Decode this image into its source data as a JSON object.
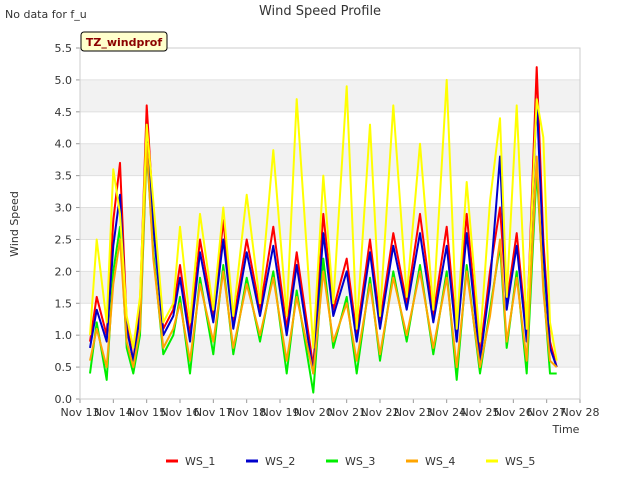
{
  "chart_data": {
    "type": "line",
    "title": "Wind Speed Profile",
    "note": "No data for f_u",
    "badge": "TZ_windprof",
    "xlabel": "Time",
    "ylabel": "Wind Speed",
    "ylim": [
      0.0,
      5.5
    ],
    "yticks": [
      "0.0",
      "0.5",
      "1.0",
      "1.5",
      "2.0",
      "2.5",
      "3.0",
      "3.5",
      "4.0",
      "4.5",
      "5.0",
      "5.5"
    ],
    "xticks": [
      "Nov 13",
      "Nov 14",
      "Nov 15",
      "Nov 16",
      "Nov 17",
      "Nov 18",
      "Nov 19",
      "Nov 20",
      "Nov 21",
      "Nov 22",
      "Nov 23",
      "Nov 24",
      "Nov 25",
      "Nov 26",
      "Nov 27",
      "Nov 28"
    ],
    "xlim_days": [
      13,
      28
    ],
    "grid": true,
    "legend_position": "bottom",
    "series": [
      {
        "name": "WS_1",
        "color": "#ff0000",
        "values": [
          [
            13.3,
            0.9
          ],
          [
            13.5,
            1.6
          ],
          [
            13.8,
            1.0
          ],
          [
            14.0,
            2.8
          ],
          [
            14.2,
            3.7
          ],
          [
            14.4,
            1.2
          ],
          [
            14.6,
            0.6
          ],
          [
            14.8,
            1.5
          ],
          [
            15.0,
            4.6
          ],
          [
            15.2,
            2.9
          ],
          [
            15.5,
            1.1
          ],
          [
            15.8,
            1.4
          ],
          [
            16.0,
            2.1
          ],
          [
            16.3,
            1.0
          ],
          [
            16.6,
            2.5
          ],
          [
            17.0,
            1.3
          ],
          [
            17.3,
            2.8
          ],
          [
            17.6,
            1.2
          ],
          [
            18.0,
            2.5
          ],
          [
            18.4,
            1.4
          ],
          [
            18.8,
            2.7
          ],
          [
            19.2,
            1.1
          ],
          [
            19.5,
            2.3
          ],
          [
            20.0,
            0.5
          ],
          [
            20.3,
            2.9
          ],
          [
            20.6,
            1.4
          ],
          [
            21.0,
            2.2
          ],
          [
            21.3,
            1.0
          ],
          [
            21.7,
            2.5
          ],
          [
            22.0,
            1.2
          ],
          [
            22.4,
            2.6
          ],
          [
            22.8,
            1.5
          ],
          [
            23.2,
            2.9
          ],
          [
            23.6,
            1.3
          ],
          [
            24.0,
            2.7
          ],
          [
            24.3,
            1.0
          ],
          [
            24.6,
            2.9
          ],
          [
            25.0,
            0.7
          ],
          [
            25.3,
            2.0
          ],
          [
            25.6,
            3.0
          ],
          [
            25.8,
            1.5
          ],
          [
            26.1,
            2.6
          ],
          [
            26.4,
            1.0
          ],
          [
            26.7,
            5.2
          ],
          [
            26.9,
            2.5
          ],
          [
            27.1,
            0.9
          ],
          [
            27.3,
            0.5
          ]
        ]
      },
      {
        "name": "WS_2",
        "color": "#0000cc",
        "values": [
          [
            13.3,
            0.8
          ],
          [
            13.5,
            1.4
          ],
          [
            13.8,
            0.9
          ],
          [
            14.0,
            2.4
          ],
          [
            14.2,
            3.2
          ],
          [
            14.4,
            1.1
          ],
          [
            14.6,
            0.6
          ],
          [
            14.8,
            1.3
          ],
          [
            15.0,
            4.3
          ],
          [
            15.2,
            2.7
          ],
          [
            15.5,
            1.0
          ],
          [
            15.8,
            1.3
          ],
          [
            16.0,
            1.9
          ],
          [
            16.3,
            0.9
          ],
          [
            16.6,
            2.3
          ],
          [
            17.0,
            1.2
          ],
          [
            17.3,
            2.5
          ],
          [
            17.6,
            1.1
          ],
          [
            18.0,
            2.3
          ],
          [
            18.4,
            1.3
          ],
          [
            18.8,
            2.4
          ],
          [
            19.2,
            1.0
          ],
          [
            19.5,
            2.1
          ],
          [
            20.0,
            0.4
          ],
          [
            20.3,
            2.6
          ],
          [
            20.6,
            1.3
          ],
          [
            21.0,
            2.0
          ],
          [
            21.3,
            0.9
          ],
          [
            21.7,
            2.3
          ],
          [
            22.0,
            1.1
          ],
          [
            22.4,
            2.4
          ],
          [
            22.8,
            1.4
          ],
          [
            23.2,
            2.6
          ],
          [
            23.6,
            1.2
          ],
          [
            24.0,
            2.4
          ],
          [
            24.3,
            0.9
          ],
          [
            24.6,
            2.6
          ],
          [
            25.0,
            0.6
          ],
          [
            25.3,
            1.8
          ],
          [
            25.6,
            3.8
          ],
          [
            25.8,
            1.4
          ],
          [
            26.1,
            2.4
          ],
          [
            26.4,
            0.9
          ],
          [
            26.7,
            4.7
          ],
          [
            26.9,
            2.3
          ],
          [
            27.1,
            0.8
          ],
          [
            27.3,
            0.5
          ]
        ]
      },
      {
        "name": "WS_3",
        "color": "#00ee00",
        "values": [
          [
            13.3,
            0.4
          ],
          [
            13.5,
            1.2
          ],
          [
            13.8,
            0.3
          ],
          [
            14.0,
            2.0
          ],
          [
            14.2,
            2.7
          ],
          [
            14.4,
            0.8
          ],
          [
            14.6,
            0.4
          ],
          [
            14.8,
            1.0
          ],
          [
            15.0,
            3.9
          ],
          [
            15.2,
            2.3
          ],
          [
            15.5,
            0.7
          ],
          [
            15.8,
            1.0
          ],
          [
            16.0,
            1.6
          ],
          [
            16.3,
            0.4
          ],
          [
            16.6,
            1.9
          ],
          [
            17.0,
            0.7
          ],
          [
            17.3,
            2.1
          ],
          [
            17.6,
            0.7
          ],
          [
            18.0,
            1.9
          ],
          [
            18.4,
            0.9
          ],
          [
            18.8,
            2.0
          ],
          [
            19.2,
            0.4
          ],
          [
            19.5,
            1.7
          ],
          [
            20.0,
            0.1
          ],
          [
            20.3,
            2.2
          ],
          [
            20.6,
            0.8
          ],
          [
            21.0,
            1.6
          ],
          [
            21.3,
            0.4
          ],
          [
            21.7,
            1.9
          ],
          [
            22.0,
            0.6
          ],
          [
            22.4,
            2.0
          ],
          [
            22.8,
            0.9
          ],
          [
            23.2,
            2.1
          ],
          [
            23.6,
            0.7
          ],
          [
            24.0,
            2.0
          ],
          [
            24.3,
            0.3
          ],
          [
            24.6,
            2.1
          ],
          [
            25.0,
            0.4
          ],
          [
            25.3,
            1.4
          ],
          [
            25.6,
            2.4
          ],
          [
            25.8,
            0.8
          ],
          [
            26.1,
            2.0
          ],
          [
            26.4,
            0.4
          ],
          [
            26.7,
            3.6
          ],
          [
            26.9,
            1.8
          ],
          [
            27.1,
            0.4
          ],
          [
            27.3,
            0.4
          ]
        ]
      },
      {
        "name": "WS_4",
        "color": "#ffa500",
        "values": [
          [
            13.3,
            0.6
          ],
          [
            13.5,
            1.1
          ],
          [
            13.8,
            0.5
          ],
          [
            14.0,
            1.8
          ],
          [
            14.2,
            2.5
          ],
          [
            14.4,
            0.9
          ],
          [
            14.6,
            0.5
          ],
          [
            14.8,
            1.1
          ],
          [
            15.0,
            4.0
          ],
          [
            15.2,
            2.2
          ],
          [
            15.5,
            0.8
          ],
          [
            15.8,
            1.1
          ],
          [
            16.0,
            1.5
          ],
          [
            16.3,
            0.6
          ],
          [
            16.6,
            1.8
          ],
          [
            17.0,
            0.9
          ],
          [
            17.3,
            2.0
          ],
          [
            17.6,
            0.8
          ],
          [
            18.0,
            1.8
          ],
          [
            18.4,
            1.0
          ],
          [
            18.8,
            1.9
          ],
          [
            19.2,
            0.6
          ],
          [
            19.5,
            1.6
          ],
          [
            20.0,
            0.4
          ],
          [
            20.3,
            2.0
          ],
          [
            20.6,
            0.9
          ],
          [
            21.0,
            1.5
          ],
          [
            21.3,
            0.6
          ],
          [
            21.7,
            1.8
          ],
          [
            22.0,
            0.7
          ],
          [
            22.4,
            1.9
          ],
          [
            22.8,
            1.0
          ],
          [
            23.2,
            2.0
          ],
          [
            23.6,
            0.8
          ],
          [
            24.0,
            1.9
          ],
          [
            24.3,
            0.5
          ],
          [
            24.6,
            2.0
          ],
          [
            25.0,
            0.5
          ],
          [
            25.3,
            1.3
          ],
          [
            25.6,
            2.5
          ],
          [
            25.8,
            0.9
          ],
          [
            26.1,
            1.9
          ],
          [
            26.4,
            0.6
          ],
          [
            26.7,
            3.8
          ],
          [
            26.9,
            1.7
          ],
          [
            27.1,
            0.6
          ],
          [
            27.3,
            0.5
          ]
        ]
      },
      {
        "name": "WS_5",
        "color": "#ffff00",
        "values": [
          [
            13.3,
            1.0
          ],
          [
            13.5,
            2.5
          ],
          [
            13.8,
            1.2
          ],
          [
            14.0,
            3.6
          ],
          [
            14.2,
            2.9
          ],
          [
            14.4,
            1.3
          ],
          [
            14.6,
            0.8
          ],
          [
            14.8,
            1.6
          ],
          [
            15.0,
            4.3
          ],
          [
            15.2,
            3.1
          ],
          [
            15.5,
            1.2
          ],
          [
            15.8,
            1.5
          ],
          [
            16.0,
            2.7
          ],
          [
            16.3,
            1.2
          ],
          [
            16.6,
            2.9
          ],
          [
            17.0,
            1.4
          ],
          [
            17.3,
            3.0
          ],
          [
            17.6,
            1.3
          ],
          [
            18.0,
            3.2
          ],
          [
            18.4,
            1.5
          ],
          [
            18.8,
            3.9
          ],
          [
            19.2,
            1.3
          ],
          [
            19.5,
            4.7
          ],
          [
            20.0,
            0.8
          ],
          [
            20.3,
            3.5
          ],
          [
            20.6,
            1.5
          ],
          [
            21.0,
            4.9
          ],
          [
            21.3,
            1.1
          ],
          [
            21.7,
            4.3
          ],
          [
            22.0,
            1.3
          ],
          [
            22.4,
            4.6
          ],
          [
            22.8,
            1.6
          ],
          [
            23.2,
            4.0
          ],
          [
            23.6,
            1.4
          ],
          [
            24.0,
            5.0
          ],
          [
            24.3,
            1.1
          ],
          [
            24.6,
            3.4
          ],
          [
            25.0,
            0.9
          ],
          [
            25.3,
            3.1
          ],
          [
            25.6,
            4.4
          ],
          [
            25.8,
            1.6
          ],
          [
            26.1,
            4.6
          ],
          [
            26.4,
            1.1
          ],
          [
            26.7,
            4.7
          ],
          [
            26.9,
            4.1
          ],
          [
            27.1,
            1.2
          ],
          [
            27.3,
            0.6
          ]
        ]
      }
    ]
  }
}
